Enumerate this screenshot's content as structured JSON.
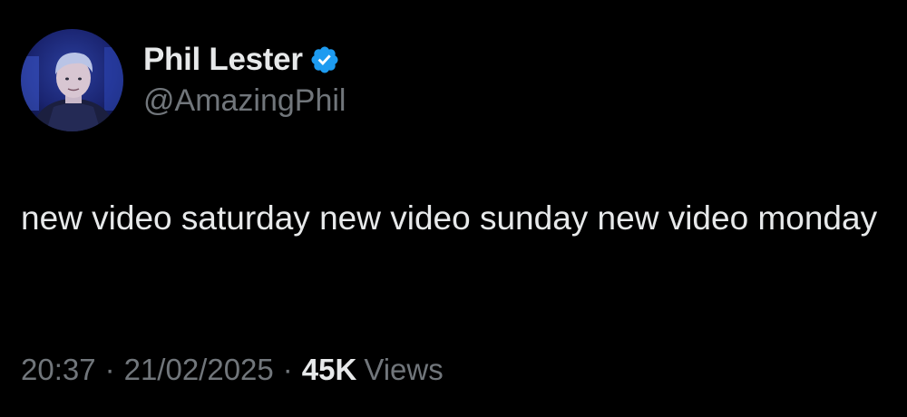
{
  "author": {
    "display_name": "Phil Lester",
    "handle": "@AmazingPhil",
    "verified_icon": "verified-badge-icon",
    "avatar_icon": "profile-photo"
  },
  "tweet": {
    "text": "new video saturday new video sunday new video monday"
  },
  "meta": {
    "time": "20:37",
    "separator": "·",
    "date": "21/02/2025",
    "views_count": "45K",
    "views_label": "Views"
  },
  "colors": {
    "background": "#000000",
    "primary_text": "#e7e9ea",
    "secondary_text": "#71767b",
    "verified_blue": "#1d9bf0"
  }
}
